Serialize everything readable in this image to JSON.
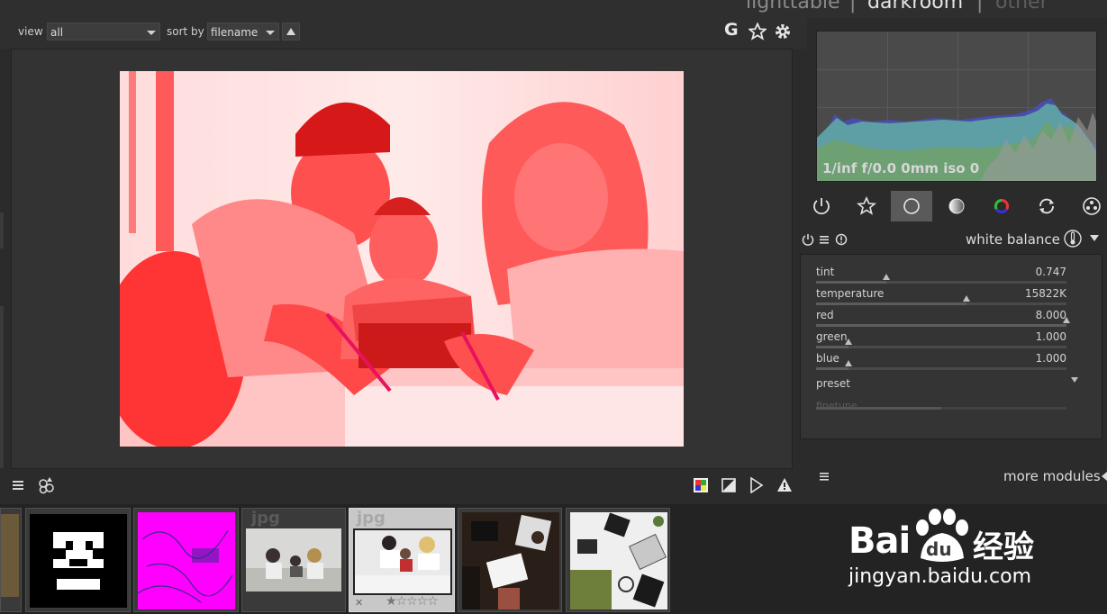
{
  "header": {
    "view_label": "view",
    "view_value": "all",
    "sort_label": "sort by",
    "sort_value": "filename",
    "tab_lighttable": "lighttable",
    "tab_darkroom": "darkroom",
    "tab_other": "other",
    "separator": "|",
    "grouping_letter": "G"
  },
  "histogram": {
    "exif_info": "1/inf f/0.0 0mm iso 0"
  },
  "module": {
    "title": "white balance",
    "sliders": [
      {
        "label": "tint",
        "value": "0.747",
        "position": 0.28
      },
      {
        "label": "temperature",
        "value": "15822K",
        "position": 0.6
      },
      {
        "label": "red",
        "value": "8.000",
        "position": 1.0
      },
      {
        "label": "green",
        "value": "1.000",
        "position": 0.13
      },
      {
        "label": "blue",
        "value": "1.000",
        "position": 0.13
      }
    ],
    "preset_label": "preset",
    "finetune_label": "finetune",
    "finetune_fill": 0.5
  },
  "footer": {
    "more_modules": "more modules"
  },
  "filmstrip": {
    "thumb_labels": [
      "jpg",
      "jpg"
    ]
  },
  "watermark": {
    "brand": "Bai",
    "brand2": "du",
    "cn": "经验",
    "url": "jingyan.baidu.com"
  },
  "colors": {
    "accent_tint": "#ff3a3a",
    "panel": "#343434",
    "histogram_fill": "#5fa8a3"
  }
}
